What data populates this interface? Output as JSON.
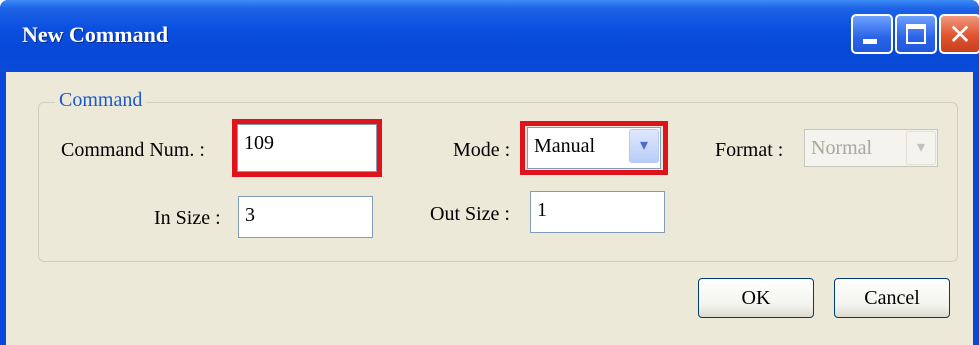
{
  "window": {
    "title": "New Command",
    "minimize_icon": "minimize-icon",
    "maximize_icon": "maximize-icon",
    "close_icon": "close-icon",
    "close_glyph": "✕"
  },
  "group": {
    "label": "Command"
  },
  "fields": {
    "command_num_label": "Command Num. :",
    "command_num_value": "109",
    "mode_label": "Mode :",
    "mode_value": "Manual",
    "format_label": "Format :",
    "format_value": "Normal",
    "in_size_label": "In Size :",
    "in_size_value": "3",
    "out_size_label": "Out Size :",
    "out_size_value": "1"
  },
  "buttons": {
    "ok": "OK",
    "cancel": "Cancel"
  },
  "dropdown_glyph": "▾",
  "colors": {
    "title_bar": "#0a4fe0",
    "highlight": "#e0121b",
    "dialog_bg": "#ece9d8",
    "group_label": "#1d5ac8"
  }
}
